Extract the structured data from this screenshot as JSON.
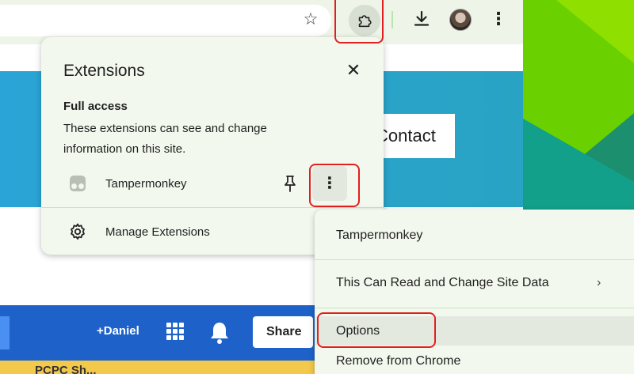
{
  "toolbar": {
    "star_icon": "star-icon",
    "extensions_icon": "puzzle-piece-icon",
    "download_icon": "download-icon",
    "menu_icon": "vertical-dots-icon"
  },
  "page": {
    "contact_label": "Contact",
    "google_bar": {
      "account_name": "+Daniel",
      "share_label": "Share",
      "strip_text": "PCPC Sh..."
    }
  },
  "extensions_popup": {
    "title": "Extensions",
    "close_icon": "close-icon",
    "section_heading": "Full access",
    "section_description": "These extensions can see and change information on this site.",
    "extensions": [
      {
        "name": "Tampermonkey",
        "pin_icon": "pin-icon",
        "more_icon": "vertical-dots-icon"
      }
    ],
    "manage_label": "Manage Extensions",
    "manage_icon": "gear-icon"
  },
  "context_menu": {
    "title": "Tampermonkey",
    "items": [
      {
        "label": "This Can Read and Change Site Data",
        "has_submenu": true
      },
      {
        "label": "Options",
        "highlighted": true
      },
      {
        "label": "Remove from Chrome"
      }
    ]
  },
  "colors": {
    "annotation_red": "#e21f1f",
    "popup_bg": "#f3f8ee",
    "page_blue": "#2aa4d6",
    "google_bar_blue": "#1e62c9"
  }
}
